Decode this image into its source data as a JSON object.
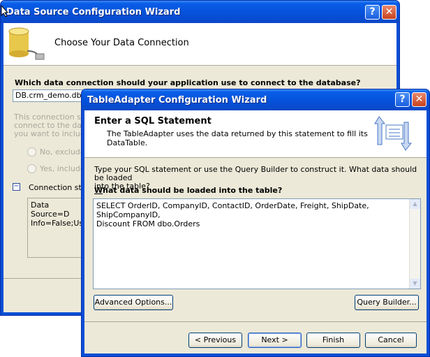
{
  "back_window": {
    "title": "Data Source Configuration Wizard",
    "header_title": "Choose Your Data Connection",
    "question_label": "Which data connection should your application use to connect to the database?",
    "connection_value": "DB.crm_demo.dbo",
    "info_text_lines": [
      "This connection strin",
      "connect to the datab",
      "you want to include"
    ],
    "radio_no": "No, exclude",
    "radio_yes": "Yes, include",
    "connection_string_toggle": "Connection strin",
    "connection_string_lines": [
      "Data Source=D",
      "Info=False;Use"
    ]
  },
  "front_window": {
    "title": "TableAdapter Configuration Wizard",
    "header_title": "Enter a SQL Statement",
    "header_description_lines": [
      "The TableAdapter uses the data returned by this statement to fill its",
      "DataTable."
    ],
    "instruction_lines": [
      "Type your SQL statement or use the Query Builder to construct it. What data should be loaded",
      "into the table?"
    ],
    "question_label_rest": "hat data should be loaded into the table?",
    "question_label_access": "W",
    "sql_lines": [
      "SELECT OrderID, CompanyID, ContactID, OrderDate, Freight, ShipDate, ShipCompanyID,",
      "Discount FROM dbo.Orders"
    ],
    "advanced_options_label": "Advanced Options...",
    "query_builder_label": "Query Builder...",
    "previous_label": "< Previous",
    "next_label": "Next >",
    "finish_label": "Finish",
    "cancel_label": "Cancel"
  },
  "colors": {
    "titlebar": "#0550d8",
    "dialog_bg": "#ece9d8",
    "close": "#c8421e"
  }
}
